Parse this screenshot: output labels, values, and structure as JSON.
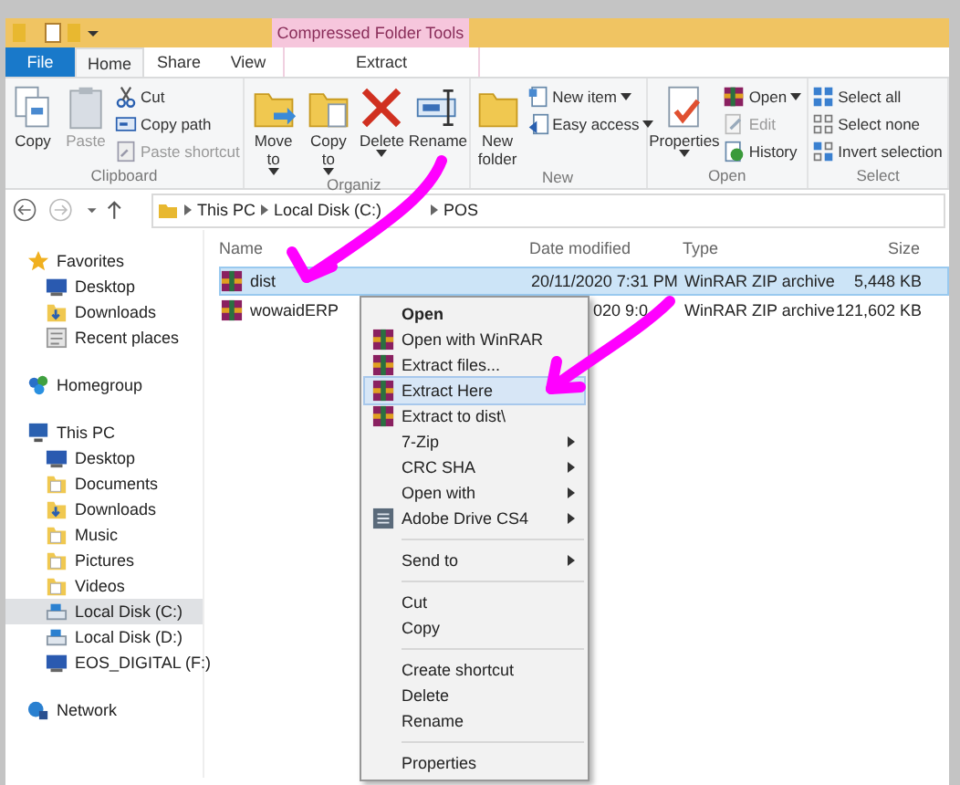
{
  "title_bar": {
    "context_tab": "Compressed Folder Tools"
  },
  "tabs": [
    {
      "label": "File",
      "kind": "file",
      "selected": false
    },
    {
      "label": "Home",
      "kind": "normal",
      "selected": true
    },
    {
      "label": "Share",
      "kind": "normal",
      "selected": false
    },
    {
      "label": "View",
      "kind": "normal",
      "selected": false
    },
    {
      "label": "Extract",
      "kind": "context",
      "selected": false
    }
  ],
  "ribbon": {
    "groups": [
      {
        "label": "Clipboard",
        "large": [
          {
            "label": "Copy",
            "kind": "copy",
            "disabled": false,
            "dropdown": false
          },
          {
            "label": "Paste",
            "kind": "paste",
            "disabled": true,
            "dropdown": false
          }
        ],
        "small": [
          {
            "label": "Cut",
            "kind": "scissors",
            "disabled": false,
            "dropdown": false
          },
          {
            "label": "Copy path",
            "kind": "path",
            "disabled": false,
            "dropdown": false
          },
          {
            "label": "Paste shortcut",
            "kind": "shortcut",
            "disabled": true,
            "dropdown": false
          }
        ]
      },
      {
        "label": "Organiz",
        "large": [
          {
            "label": "Move to",
            "kind": "move",
            "disabled": false,
            "dropdown": true
          },
          {
            "label": "Copy to",
            "kind": "copyto",
            "disabled": false,
            "dropdown": true
          },
          {
            "label": "Delete",
            "kind": "delete",
            "disabled": false,
            "dropdown": true
          },
          {
            "label": "Rename",
            "kind": "rename",
            "disabled": false,
            "dropdown": false
          }
        ]
      },
      {
        "label": "New",
        "large": [
          {
            "label": "New folder",
            "kind": "newfolder",
            "disabled": false,
            "dropdown": false
          }
        ],
        "small": [
          {
            "label": "New item",
            "kind": "newitem",
            "disabled": false,
            "dropdown": true
          },
          {
            "label": "Easy access",
            "kind": "easy",
            "disabled": false,
            "dropdown": true
          }
        ]
      },
      {
        "label": "Open",
        "large": [
          {
            "label": "Properties",
            "kind": "properties",
            "disabled": false,
            "dropdown": true
          }
        ],
        "small": [
          {
            "label": "Open",
            "kind": "winrar",
            "disabled": false,
            "dropdown": true
          },
          {
            "label": "Edit",
            "kind": "edit",
            "disabled": true,
            "dropdown": false
          },
          {
            "label": "History",
            "kind": "history",
            "disabled": false,
            "dropdown": false
          }
        ]
      },
      {
        "label": "Select",
        "small": [
          {
            "label": "Select all",
            "kind": "selall",
            "disabled": false,
            "dropdown": false
          },
          {
            "label": "Select none",
            "kind": "selnone",
            "disabled": false,
            "dropdown": false
          },
          {
            "label": "Invert selection",
            "kind": "invert",
            "disabled": false,
            "dropdown": false
          }
        ]
      }
    ]
  },
  "address": [
    "This PC",
    "Local Disk (C:)",
    "POS"
  ],
  "sidebar": {
    "items": [
      {
        "label": "Favorites",
        "kind": "star",
        "selected": false,
        "children": [
          {
            "label": "Desktop",
            "kind": "desktop",
            "selected": false
          },
          {
            "label": "Downloads",
            "kind": "downloads",
            "selected": false
          },
          {
            "label": "Recent places",
            "kind": "recent",
            "selected": false
          }
        ]
      },
      {
        "label": "Homegroup",
        "kind": "homegroup",
        "selected": false
      },
      {
        "label": "This PC",
        "kind": "pc",
        "selected": false,
        "children": [
          {
            "label": "Desktop",
            "kind": "desktop",
            "selected": false
          },
          {
            "label": "Documents",
            "kind": "folder",
            "selected": false
          },
          {
            "label": "Downloads",
            "kind": "downloads",
            "selected": false
          },
          {
            "label": "Music",
            "kind": "folder",
            "selected": false
          },
          {
            "label": "Pictures",
            "kind": "folder",
            "selected": false
          },
          {
            "label": "Videos",
            "kind": "folder",
            "selected": false
          },
          {
            "label": "Local Disk (C:)",
            "kind": "drive",
            "selected": true
          },
          {
            "label": "Local Disk (D:)",
            "kind": "drive",
            "selected": false
          },
          {
            "label": "EOS_DIGITAL (F:)",
            "kind": "desktop",
            "selected": false
          }
        ]
      },
      {
        "label": "Network",
        "kind": "network",
        "selected": false
      }
    ]
  },
  "table": {
    "columns": [
      "Name",
      "Date modified",
      "Type",
      "Size"
    ],
    "rows": [
      {
        "name": "dist",
        "date": "20/11/2020 7:31 PM",
        "type": "WinRAR ZIP archive",
        "size": "5,448 KB",
        "selected": true
      },
      {
        "name": "wowaidERP",
        "date": "020 9:0",
        "type": "WinRAR ZIP archive",
        "size": "121,602 KB",
        "selected": false
      }
    ]
  },
  "context_menu": {
    "groups": [
      [
        {
          "label": "Open",
          "kind": "plain",
          "bold": true,
          "submenu": false,
          "selected": false
        },
        {
          "label": "Open with WinRAR",
          "kind": "winrar",
          "bold": false,
          "submenu": false,
          "selected": false
        },
        {
          "label": "Extract files...",
          "kind": "winrar",
          "bold": false,
          "submenu": false,
          "selected": false
        },
        {
          "label": "Extract Here",
          "kind": "winrar",
          "bold": false,
          "submenu": false,
          "selected": true
        },
        {
          "label": "Extract to dist\\",
          "kind": "winrar",
          "bold": false,
          "submenu": false,
          "selected": false
        },
        {
          "label": "7-Zip",
          "kind": "plain",
          "bold": false,
          "submenu": true,
          "selected": false
        },
        {
          "label": "CRC SHA",
          "kind": "plain",
          "bold": false,
          "submenu": true,
          "selected": false
        },
        {
          "label": "Open with",
          "kind": "plain",
          "bold": false,
          "submenu": true,
          "selected": false
        },
        {
          "label": "Adobe Drive CS4",
          "kind": "adobe",
          "bold": false,
          "submenu": true,
          "selected": false
        }
      ],
      [
        {
          "label": "Send to",
          "kind": "plain",
          "bold": false,
          "submenu": true,
          "selected": false
        }
      ],
      [
        {
          "label": "Cut",
          "kind": "plain",
          "bold": false,
          "submenu": false,
          "selected": false
        },
        {
          "label": "Copy",
          "kind": "plain",
          "bold": false,
          "submenu": false,
          "selected": false
        }
      ],
      [
        {
          "label": "Create shortcut",
          "kind": "plain",
          "bold": false,
          "submenu": false,
          "selected": false
        },
        {
          "label": "Delete",
          "kind": "plain",
          "bold": false,
          "submenu": false,
          "selected": false
        },
        {
          "label": "Rename",
          "kind": "plain",
          "bold": false,
          "submenu": false,
          "selected": false
        }
      ],
      [
        {
          "label": "Properties",
          "kind": "plain",
          "bold": false,
          "submenu": false,
          "selected": false
        }
      ]
    ]
  }
}
